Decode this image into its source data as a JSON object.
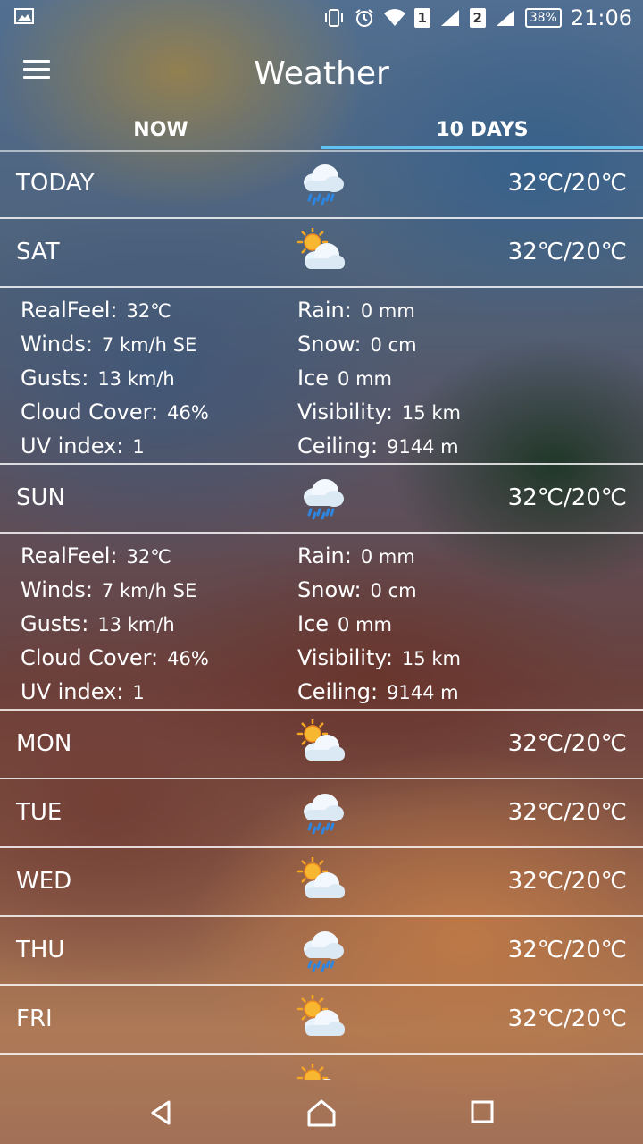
{
  "status_bar": {
    "icons": [
      "image-icon",
      "vibrate-icon",
      "alarm-icon",
      "wifi-icon",
      "sim1-signal-icon",
      "sim2-signal-icon",
      "battery-icon"
    ],
    "sim1": "1",
    "sim2": "2",
    "battery": "38%",
    "time": "21:06"
  },
  "header": {
    "title": "Weather"
  },
  "tabs": [
    {
      "label": "NOW",
      "active": false
    },
    {
      "label": "10 DAYS",
      "active": true
    }
  ],
  "accent_color": "#5ec3f0",
  "detail_labels": {
    "realfeel": "RealFeel:",
    "winds": "Winds:",
    "gusts": "Gusts:",
    "cloud_cover": "Cloud Cover:",
    "uv_index": "UV index:",
    "rain": "Rain:",
    "snow": "Snow:",
    "ice": "Ice",
    "visibility": "Visibility:",
    "ceiling": "Ceiling:"
  },
  "days": [
    {
      "day": "TODAY",
      "icon": "rain-cloud-icon",
      "temp": "32℃/20℃"
    },
    {
      "day": "SAT",
      "icon": "partly-cloudy-icon",
      "temp": "32℃/20℃",
      "details": {
        "realfeel": "32℃",
        "winds": "7 km/h SE",
        "gusts": "13 km/h",
        "cloud_cover": "46%",
        "uv_index": "1",
        "rain": "0 mm",
        "snow": "0 cm",
        "ice": "0 mm",
        "visibility": "15 km",
        "ceiling": "9144 m"
      }
    },
    {
      "day": "SUN",
      "icon": "rain-cloud-icon",
      "temp": "32℃/20℃",
      "details": {
        "realfeel": "32℃",
        "winds": "7 km/h SE",
        "gusts": "13 km/h",
        "cloud_cover": "46%",
        "uv_index": "1",
        "rain": "0 mm",
        "snow": "0 cm",
        "ice": "0 mm",
        "visibility": "15 km",
        "ceiling": "9144 m"
      }
    },
    {
      "day": "MON",
      "icon": "partly-cloudy-icon",
      "temp": "32℃/20℃"
    },
    {
      "day": "TUE",
      "icon": "rain-cloud-icon",
      "temp": "32℃/20℃"
    },
    {
      "day": "WED",
      "icon": "partly-cloudy-icon",
      "temp": "32℃/20℃"
    },
    {
      "day": "THU",
      "icon": "rain-cloud-icon",
      "temp": "32℃/20℃"
    },
    {
      "day": "FRI",
      "icon": "partly-cloudy-icon",
      "temp": "32℃/20℃"
    },
    {
      "day": "",
      "icon": "partly-cloudy-icon",
      "temp": ""
    }
  ],
  "nav_bar": {
    "icons": [
      "back-icon",
      "home-icon",
      "recents-icon"
    ]
  }
}
